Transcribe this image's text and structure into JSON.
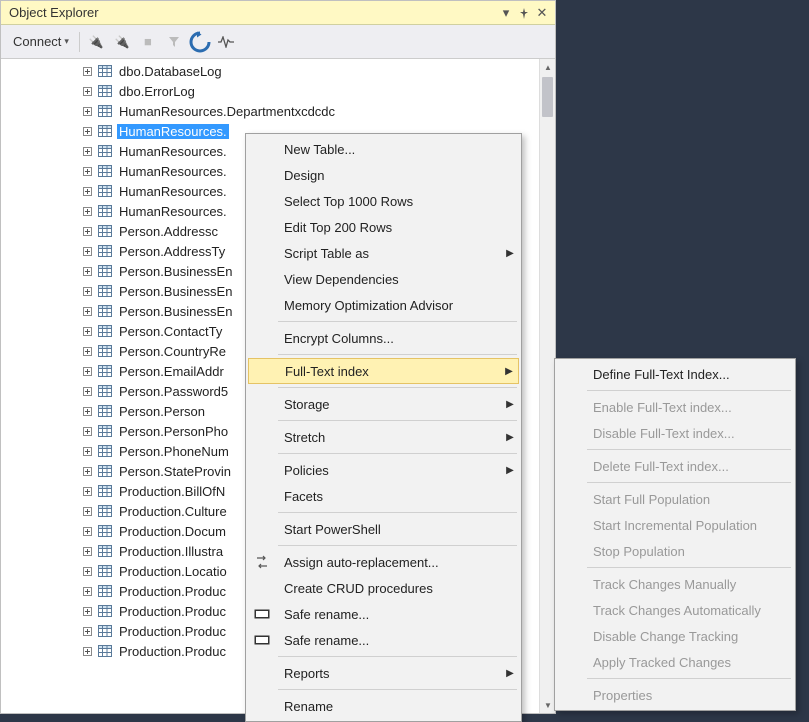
{
  "panel": {
    "title": "Object Explorer"
  },
  "toolbar": {
    "connect_label": "Connect"
  },
  "tree": {
    "items": [
      {
        "label": "dbo.DatabaseLog",
        "selected": false
      },
      {
        "label": "dbo.ErrorLog",
        "selected": false
      },
      {
        "label": "HumanResources.Departmentxcdcdc",
        "selected": false
      },
      {
        "label": "HumanResources.",
        "selected": true
      },
      {
        "label": "HumanResources.",
        "selected": false
      },
      {
        "label": "HumanResources.",
        "selected": false
      },
      {
        "label": "HumanResources.",
        "selected": false
      },
      {
        "label": "HumanResources.",
        "selected": false
      },
      {
        "label": "Person.Addressc",
        "selected": false
      },
      {
        "label": "Person.AddressTy",
        "selected": false
      },
      {
        "label": "Person.BusinessEn",
        "selected": false
      },
      {
        "label": "Person.BusinessEn",
        "selected": false
      },
      {
        "label": "Person.BusinessEn",
        "selected": false
      },
      {
        "label": "Person.ContactTy",
        "selected": false
      },
      {
        "label": "Person.CountryRe",
        "selected": false
      },
      {
        "label": "Person.EmailAddr",
        "selected": false
      },
      {
        "label": "Person.Password5",
        "selected": false
      },
      {
        "label": "Person.Person",
        "selected": false
      },
      {
        "label": "Person.PersonPho",
        "selected": false
      },
      {
        "label": "Person.PhoneNum",
        "selected": false
      },
      {
        "label": "Person.StateProvin",
        "selected": false
      },
      {
        "label": "Production.BillOfN",
        "selected": false
      },
      {
        "label": "Production.Culture",
        "selected": false
      },
      {
        "label": "Production.Docum",
        "selected": false
      },
      {
        "label": "Production.Illustra",
        "selected": false
      },
      {
        "label": "Production.Locatio",
        "selected": false
      },
      {
        "label": "Production.Produc",
        "selected": false
      },
      {
        "label": "Production.Produc",
        "selected": false
      },
      {
        "label": "Production.Produc",
        "selected": false
      },
      {
        "label": "Production.Produc",
        "selected": false
      }
    ]
  },
  "menu1": [
    {
      "type": "item",
      "label": "New Table..."
    },
    {
      "type": "item",
      "label": "Design"
    },
    {
      "type": "item",
      "label": "Select Top 1000 Rows"
    },
    {
      "type": "item",
      "label": "Edit Top 200 Rows"
    },
    {
      "type": "item",
      "label": "Script Table as",
      "arrow": true
    },
    {
      "type": "item",
      "label": "View Dependencies"
    },
    {
      "type": "item",
      "label": "Memory Optimization Advisor"
    },
    {
      "type": "sep"
    },
    {
      "type": "item",
      "label": "Encrypt Columns..."
    },
    {
      "type": "sep"
    },
    {
      "type": "item",
      "label": "Full-Text index",
      "arrow": true,
      "highlight": true
    },
    {
      "type": "sep"
    },
    {
      "type": "item",
      "label": "Storage",
      "arrow": true
    },
    {
      "type": "sep"
    },
    {
      "type": "item",
      "label": "Stretch",
      "arrow": true
    },
    {
      "type": "sep"
    },
    {
      "type": "item",
      "label": "Policies",
      "arrow": true
    },
    {
      "type": "item",
      "label": "Facets"
    },
    {
      "type": "sep"
    },
    {
      "type": "item",
      "label": "Start PowerShell"
    },
    {
      "type": "sep"
    },
    {
      "type": "item",
      "label": "Assign auto-replacement...",
      "icon": "swap"
    },
    {
      "type": "item",
      "label": "Create CRUD procedures"
    },
    {
      "type": "item",
      "label": "Safe rename...",
      "icon": "rename"
    },
    {
      "type": "item",
      "label": "Safe rename...",
      "icon": "rename"
    },
    {
      "type": "sep"
    },
    {
      "type": "item",
      "label": "Reports",
      "arrow": true
    },
    {
      "type": "sep"
    },
    {
      "type": "item",
      "label": "Rename"
    }
  ],
  "menu2": [
    {
      "type": "item",
      "label": "Define Full-Text Index..."
    },
    {
      "type": "sep"
    },
    {
      "type": "item",
      "label": "Enable Full-Text index...",
      "disabled": true
    },
    {
      "type": "item",
      "label": "Disable Full-Text index...",
      "disabled": true
    },
    {
      "type": "sep"
    },
    {
      "type": "item",
      "label": "Delete Full-Text index...",
      "disabled": true
    },
    {
      "type": "sep"
    },
    {
      "type": "item",
      "label": "Start Full Population",
      "disabled": true
    },
    {
      "type": "item",
      "label": "Start Incremental Population",
      "disabled": true
    },
    {
      "type": "item",
      "label": "Stop Population",
      "disabled": true
    },
    {
      "type": "sep"
    },
    {
      "type": "item",
      "label": "Track Changes Manually",
      "disabled": true
    },
    {
      "type": "item",
      "label": "Track Changes Automatically",
      "disabled": true
    },
    {
      "type": "item",
      "label": "Disable Change Tracking",
      "disabled": true
    },
    {
      "type": "item",
      "label": "Apply Tracked Changes",
      "disabled": true
    },
    {
      "type": "sep"
    },
    {
      "type": "item",
      "label": "Properties",
      "disabled": true
    }
  ]
}
